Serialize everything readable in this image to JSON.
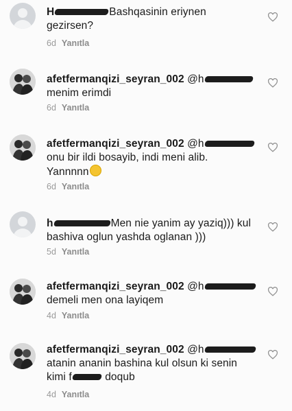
{
  "comments": [
    {
      "user": "H",
      "mention": "",
      "text_line1": "Bashqasinin eriynen",
      "text_line2": "gezirsen?",
      "time": "6d",
      "reply": "Yanıtla"
    },
    {
      "user": "afetfermanqizi_seyran_002",
      "mention": "@h",
      "text_line1": "menim erimdi",
      "text_line2": "",
      "time": "6d",
      "reply": "Yanıtla"
    },
    {
      "user": "afetfermanqizi_seyran_002",
      "mention": "@h",
      "text_line1": "onu bir ildi bosayib, indi meni alib.",
      "text_line2": "Yannnnn",
      "time": "6d",
      "reply": "Yanıtla"
    },
    {
      "user": "h",
      "mention": "",
      "text_line1": "Men nie yanim ay yaziq))) kul",
      "text_line2": "bashiva oglun yashda oglanan )))",
      "time": "5d",
      "reply": "Yanıtla"
    },
    {
      "user": "afetfermanqizi_seyran_002",
      "mention": "@h",
      "text_line1": "demeli men ona layiqem",
      "text_line2": "",
      "time": "4d",
      "reply": "Yanıtla"
    },
    {
      "user": "afetfermanqizi_seyran_002",
      "mention": "@h",
      "text_line1": "atanin ananin bashina kul olsun ki senin",
      "text_line2": "kimi f",
      "text_line2_end": "doqub",
      "time": "4d",
      "reply": "Yanıtla"
    }
  ],
  "icons": {
    "heart": "heart-outline-icon",
    "emoji": "grinning-face-emoji"
  },
  "colors": {
    "background": "#fbfbfb",
    "text": "#1a1a1a",
    "meta": "#9a9a9a",
    "redaction": "#1c1c1c"
  }
}
